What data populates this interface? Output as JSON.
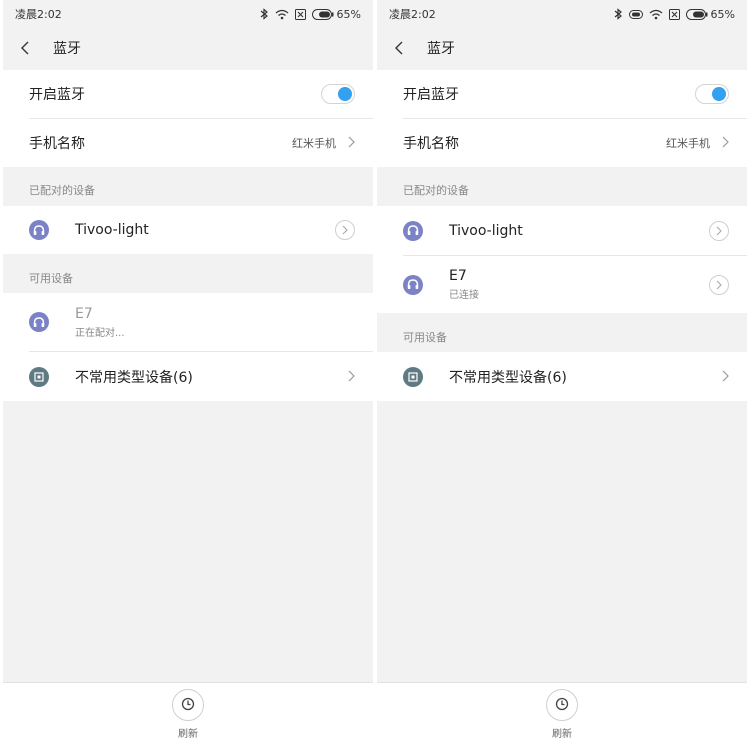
{
  "screens": [
    {
      "status": {
        "time": "凌晨2:02",
        "battery": "65%"
      },
      "title": "蓝牙",
      "settings": {
        "bluetooth_label": "开启蓝牙",
        "bluetooth_on": true,
        "phone_name_label": "手机名称",
        "phone_name_value": "红米手机"
      },
      "paired_header": "已配对的设备",
      "paired": [
        {
          "name": "Tivoo-light",
          "icon": "headphones-icon"
        }
      ],
      "available_header": "可用设备",
      "available": [
        {
          "name": "E7",
          "status": "正在配对...",
          "icon": "headphones-icon"
        },
        {
          "name": "不常用类型设备(6)",
          "icon": "device-box-icon"
        }
      ],
      "refresh_label": "刷新"
    },
    {
      "status": {
        "time": "凌晨2:02",
        "battery": "65%"
      },
      "title": "蓝牙",
      "settings": {
        "bluetooth_label": "开启蓝牙",
        "bluetooth_on": true,
        "phone_name_label": "手机名称",
        "phone_name_value": "红米手机"
      },
      "paired_header": "已配对的设备",
      "paired": [
        {
          "name": "Tivoo-light",
          "icon": "headphones-icon"
        },
        {
          "name": "E7",
          "status": "已连接",
          "icon": "headphones-icon"
        }
      ],
      "available_header": "可用设备",
      "available": [
        {
          "name": "不常用类型设备(6)",
          "icon": "device-box-icon"
        }
      ],
      "refresh_label": "刷新"
    }
  ],
  "colors": {
    "accent": "#34a0f0",
    "headphone_icon_bg": "#7b83c6",
    "device_icon_bg": "#5f7a82"
  }
}
